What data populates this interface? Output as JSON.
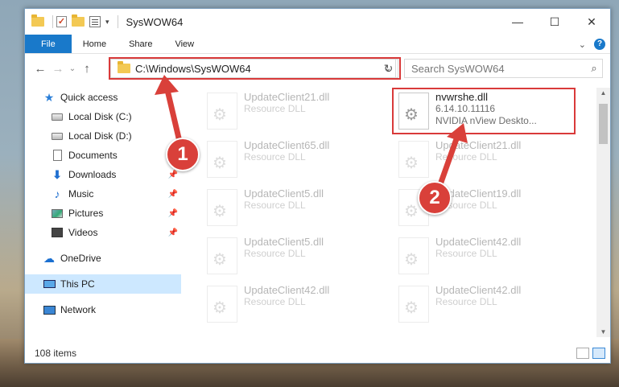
{
  "window": {
    "title": "SysWOW64",
    "controls": [
      "minimize",
      "maximize",
      "close"
    ]
  },
  "ribbon": {
    "tabs": [
      "File",
      "Home",
      "Share",
      "View"
    ]
  },
  "address_bar": {
    "path": "C:\\Windows\\SysWOW64"
  },
  "search": {
    "placeholder": "Search SysWOW64"
  },
  "sidebar": {
    "items": [
      {
        "label": "Quick access",
        "icon": "star-icon"
      },
      {
        "label": "Local Disk (C:)",
        "icon": "drive-icon"
      },
      {
        "label": "Local Disk (D:)",
        "icon": "drive-icon"
      },
      {
        "label": "Documents",
        "icon": "documents-icon"
      },
      {
        "label": "Downloads",
        "icon": "downloads-icon",
        "pinned": true
      },
      {
        "label": "Music",
        "icon": "music-icon",
        "pinned": true
      },
      {
        "label": "Pictures",
        "icon": "pictures-icon",
        "pinned": true
      },
      {
        "label": "Videos",
        "icon": "videos-icon",
        "pinned": true
      },
      {
        "label": "OneDrive",
        "icon": "onedrive-icon"
      },
      {
        "label": "This PC",
        "icon": "this-pc-icon",
        "selected": true
      },
      {
        "label": "Network",
        "icon": "network-icon"
      }
    ]
  },
  "files": [
    {
      "name": "UpdateClient21.dll",
      "sub": "Resource DLL",
      "faded": true
    },
    {
      "name": "nvwrshe.dll",
      "sub": "6.14.10.11116",
      "sub2": "NVIDIA nView Deskto...",
      "faded": false
    },
    {
      "name": "UpdateClient65.dll",
      "sub": "Resource DLL",
      "faded": true
    },
    {
      "name": "UpdateClient21.dll",
      "sub": "Resource DLL",
      "faded": true
    },
    {
      "name": "UpdateClient5.dll",
      "sub": "Resource DLL",
      "faded": true
    },
    {
      "name": "UpdateClient19.dll",
      "sub": "Resource DLL",
      "faded": true
    },
    {
      "name": "UpdateClient5.dll",
      "sub": "Resource DLL",
      "faded": true
    },
    {
      "name": "UpdateClient42.dll",
      "sub": "Resource DLL",
      "faded": true
    },
    {
      "name": "UpdateClient42.dll",
      "sub": "Resource DLL",
      "faded": true
    },
    {
      "name": "UpdateClient42.dll",
      "sub": "Resource DLL",
      "faded": true
    }
  ],
  "status": {
    "item_count": "108 items"
  },
  "annotations": {
    "step1": "1",
    "step2": "2",
    "color": "#d9403a"
  }
}
